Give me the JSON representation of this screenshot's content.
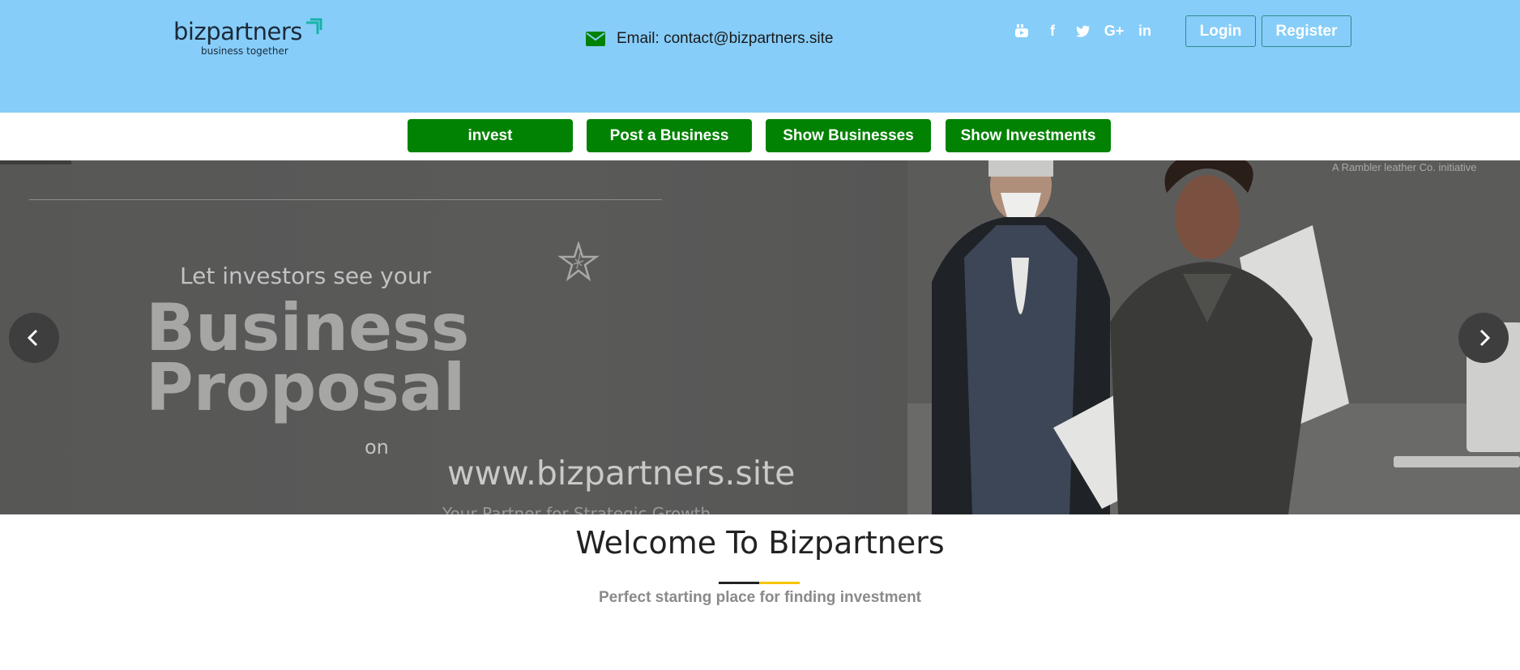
{
  "header": {
    "logo": {
      "name": "bizpartners",
      "tagline": "business together"
    },
    "email_text": "Email: contact@bizpartners.site",
    "social": [
      {
        "icon": "youtube-icon",
        "label": ""
      },
      {
        "icon": "facebook-icon",
        "label": "f"
      },
      {
        "icon": "twitter-icon",
        "label": ""
      },
      {
        "icon": "google-plus-icon",
        "label": "G+"
      },
      {
        "icon": "linkedin-icon",
        "label": "in"
      }
    ],
    "login_label": "Login",
    "register_label": "Register"
  },
  "nav": {
    "invest": "invest",
    "post_business": "Post a Business",
    "show_businesses": "Show Businesses",
    "show_investments": "Show Investments"
  },
  "hero": {
    "line1": "Let investors see your",
    "line2": "Business",
    "line3": "Proposal",
    "on": "on",
    "url": "www.bizpartners.site",
    "tagline": "Your Partner for Strategic Growth",
    "initiative": "A Rambler leather Co. initiative"
  },
  "welcome": {
    "title": "Welcome To Bizpartners",
    "subtitle": "Perfect starting place for finding investment"
  },
  "colors": {
    "topbar": "#87cdf9",
    "nav_green": "#028202",
    "accent_yellow": "#f5c400"
  }
}
